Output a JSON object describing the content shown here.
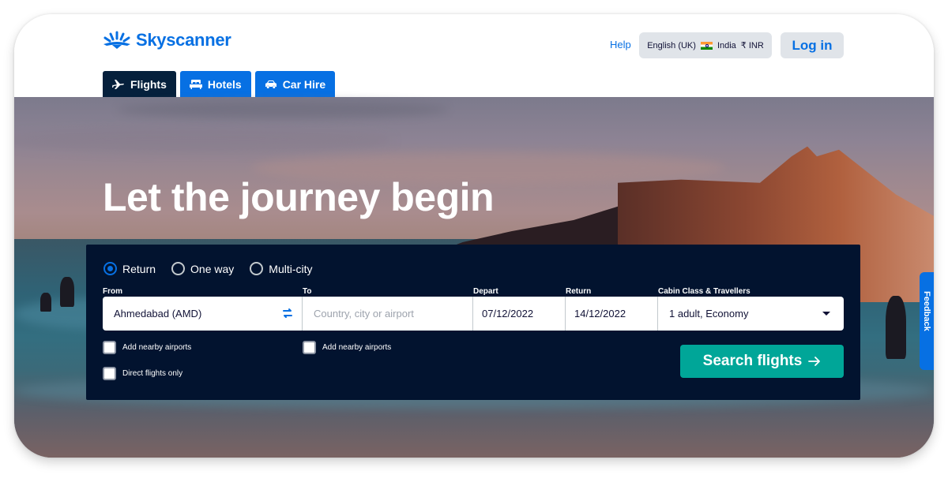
{
  "brand": {
    "name": "Skyscanner",
    "color": "#0770e3"
  },
  "header": {
    "help_label": "Help",
    "locale": {
      "language": "English (UK)",
      "country": "India",
      "currency": "₹ INR"
    },
    "login_label": "Log in"
  },
  "tabs": [
    {
      "label": "Flights",
      "icon": "plane-icon",
      "active": true
    },
    {
      "label": "Hotels",
      "icon": "bed-icon",
      "active": false
    },
    {
      "label": "Car Hire",
      "icon": "car-icon",
      "active": false
    }
  ],
  "hero": {
    "title": "Let the journey begin"
  },
  "search": {
    "trip_types": [
      {
        "label": "Return",
        "selected": true
      },
      {
        "label": "One way",
        "selected": false
      },
      {
        "label": "Multi-city",
        "selected": false
      }
    ],
    "labels": {
      "from": "From",
      "to": "To",
      "depart": "Depart",
      "return": "Return",
      "cabin": "Cabin Class & Travellers"
    },
    "from_value": "Ahmedabad (AMD)",
    "to_placeholder": "Country, city or airport",
    "depart_value": "07/12/2022",
    "return_value": "14/12/2022",
    "cabin_value": "1 adult, Economy",
    "checkboxes": {
      "from_nearby": "Add nearby airports",
      "to_nearby": "Add nearby airports",
      "direct_only": "Direct flights only"
    },
    "submit_label": "Search flights",
    "submit_color": "#00a698"
  },
  "feedback_label": "Feedback"
}
